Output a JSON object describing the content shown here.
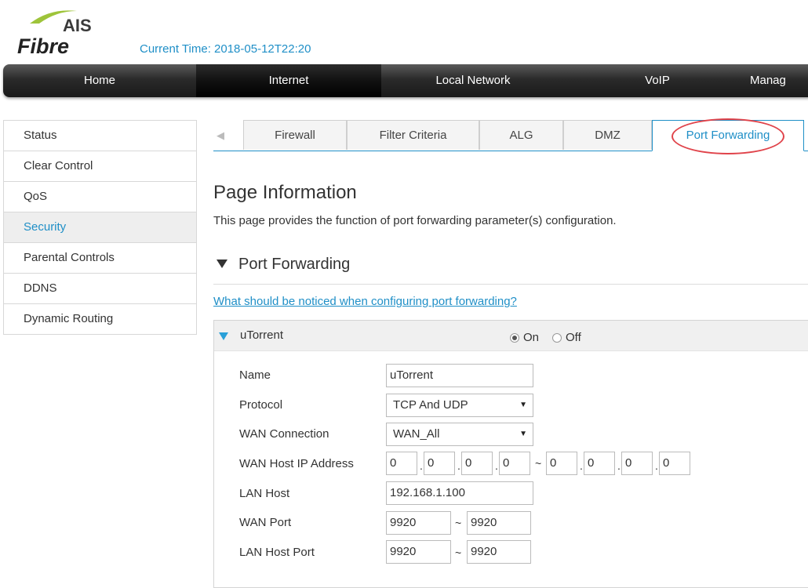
{
  "header": {
    "logo_text_top": "AIS",
    "logo_text_bottom": "Fibre",
    "time_label": "Current Time:",
    "time_value": "2018-05-12T22:20"
  },
  "topnav": {
    "items": [
      "Home",
      "Internet",
      "Local Network",
      "VoIP",
      "Manag"
    ],
    "active": "Internet"
  },
  "sidebar": {
    "items": [
      "Status",
      "Clear Control",
      "QoS",
      "Security",
      "Parental Controls",
      "DDNS",
      "Dynamic Routing"
    ],
    "active": "Security"
  },
  "subtabs": {
    "items": [
      "Firewall",
      "Filter Criteria",
      "ALG",
      "DMZ",
      "Port Forwarding"
    ],
    "active": "Port Forwarding"
  },
  "page": {
    "title": "Page Information",
    "description": "This page provides the function of port forwarding parameter(s) configuration.",
    "section_title": "Port Forwarding",
    "notice_link": "What should be noticed when configuring port forwarding?"
  },
  "rule": {
    "name": "uTorrent",
    "on_label": "On",
    "off_label": "Off",
    "selected": "On",
    "labels": {
      "name": "Name",
      "protocol": "Protocol",
      "wan_connection": "WAN Connection",
      "wan_host_ip": "WAN Host IP Address",
      "lan_host": "LAN Host",
      "wan_port": "WAN Port",
      "lan_host_port": "LAN Host Port"
    },
    "values": {
      "name": "uTorrent",
      "protocol": "TCP And UDP",
      "wan_connection": "WAN_All",
      "wan_ip_start": [
        "0",
        "0",
        "0",
        "0"
      ],
      "wan_ip_end": [
        "0",
        "0",
        "0",
        "0"
      ],
      "lan_host": "192.168.1.100",
      "wan_port_start": "9920",
      "wan_port_end": "9920",
      "lan_port_start": "9920",
      "lan_port_end": "9920"
    },
    "range_sep": "~",
    "ip_dot": "."
  },
  "colors": {
    "accent": "#1f8fc7",
    "highlight_ellipse": "#e0434a"
  }
}
